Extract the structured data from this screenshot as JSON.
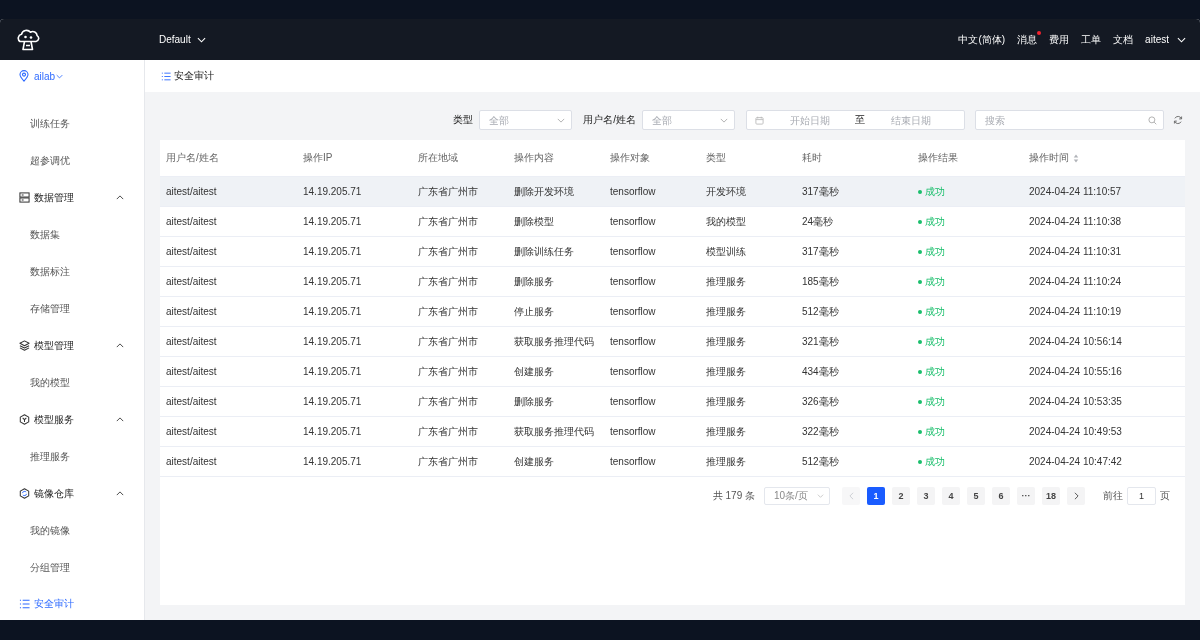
{
  "header": {
    "workspace": "Default",
    "nav": [
      {
        "label": "中文(简体)",
        "dot": false
      },
      {
        "label": "消息",
        "dot": true
      },
      {
        "label": "费用",
        "dot": false
      },
      {
        "label": "工单",
        "dot": false
      },
      {
        "label": "文档",
        "dot": false
      }
    ],
    "user": "aitest"
  },
  "sidebar": {
    "project": "ailab",
    "menu": [
      {
        "kind": "tail",
        "children": [
          {
            "label": "训练任务",
            "selected": false
          },
          {
            "label": "超参调优",
            "selected": false
          }
        ]
      },
      {
        "kind": "group",
        "label": "数据管理",
        "expanded": true,
        "children": [
          {
            "label": "数据集",
            "selected": false
          },
          {
            "label": "数据标注",
            "selected": false
          },
          {
            "label": "存储管理",
            "selected": false
          }
        ]
      },
      {
        "kind": "group",
        "label": "模型管理",
        "expanded": true,
        "children": [
          {
            "label": "我的模型",
            "selected": false
          }
        ]
      },
      {
        "kind": "group",
        "label": "模型服务",
        "expanded": true,
        "children": [
          {
            "label": "推理服务",
            "selected": false
          }
        ]
      },
      {
        "kind": "group",
        "label": "镜像仓库",
        "expanded": true,
        "children": [
          {
            "label": "我的镜像",
            "selected": false
          },
          {
            "label": "分组管理",
            "selected": false
          }
        ]
      },
      {
        "kind": "item",
        "label": "安全审计",
        "selected": true
      }
    ]
  },
  "page_title": "安全审计",
  "filters": {
    "type_label": "类型",
    "type_select": {
      "placeholder": "全部"
    },
    "user_label": "用户名/姓名",
    "user_select": {
      "placeholder": "全部"
    },
    "date_range": {
      "start_placeholder": "开始日期",
      "separator": "至",
      "end_placeholder": "结束日期"
    },
    "search": {
      "placeholder": "搜索"
    }
  },
  "table": {
    "columns": [
      {
        "label": "用户名/姓名",
        "kind": "text",
        "sortable": false
      },
      {
        "label": "操作IP",
        "kind": "text",
        "sortable": false
      },
      {
        "label": "所在地域",
        "kind": "text",
        "sortable": false
      },
      {
        "label": "操作内容",
        "kind": "text",
        "sortable": false
      },
      {
        "label": "操作对象",
        "kind": "text",
        "sortable": false
      },
      {
        "label": "类型",
        "kind": "text",
        "sortable": false
      },
      {
        "label": "耗时",
        "kind": "text",
        "sortable": false
      },
      {
        "label": "操作结果",
        "kind": "status",
        "sortable": false
      },
      {
        "label": "操作时间",
        "kind": "text",
        "sortable": true
      }
    ],
    "rows": [
      {
        "highlighted": true,
        "color": "#19be6b",
        "cells": [
          "aitest/aitest",
          "14.19.205.71",
          "广东省广州市",
          "删除开发环境",
          "tensorflow",
          "开发环境",
          "317毫秒",
          "成功",
          "2024-04-24 11:10:57"
        ]
      },
      {
        "highlighted": false,
        "color": "#19be6b",
        "cells": [
          "aitest/aitest",
          "14.19.205.71",
          "广东省广州市",
          "删除模型",
          "tensorflow",
          "我的模型",
          "24毫秒",
          "成功",
          "2024-04-24 11:10:38"
        ]
      },
      {
        "highlighted": false,
        "color": "#19be6b",
        "cells": [
          "aitest/aitest",
          "14.19.205.71",
          "广东省广州市",
          "删除训练任务",
          "tensorflow",
          "模型训练",
          "317毫秒",
          "成功",
          "2024-04-24 11:10:31"
        ]
      },
      {
        "highlighted": false,
        "color": "#19be6b",
        "cells": [
          "aitest/aitest",
          "14.19.205.71",
          "广东省广州市",
          "删除服务",
          "tensorflow",
          "推理服务",
          "185毫秒",
          "成功",
          "2024-04-24 11:10:24"
        ]
      },
      {
        "highlighted": false,
        "color": "#19be6b",
        "cells": [
          "aitest/aitest",
          "14.19.205.71",
          "广东省广州市",
          "停止服务",
          "tensorflow",
          "推理服务",
          "512毫秒",
          "成功",
          "2024-04-24 11:10:19"
        ]
      },
      {
        "highlighted": false,
        "color": "#19be6b",
        "cells": [
          "aitest/aitest",
          "14.19.205.71",
          "广东省广州市",
          "获取服务推理代码",
          "tensorflow",
          "推理服务",
          "321毫秒",
          "成功",
          "2024-04-24 10:56:14"
        ]
      },
      {
        "highlighted": false,
        "color": "#19be6b",
        "cells": [
          "aitest/aitest",
          "14.19.205.71",
          "广东省广州市",
          "创建服务",
          "tensorflow",
          "推理服务",
          "434毫秒",
          "成功",
          "2024-04-24 10:55:16"
        ]
      },
      {
        "highlighted": false,
        "color": "#19be6b",
        "cells": [
          "aitest/aitest",
          "14.19.205.71",
          "广东省广州市",
          "删除服务",
          "tensorflow",
          "推理服务",
          "326毫秒",
          "成功",
          "2024-04-24 10:53:35"
        ]
      },
      {
        "highlighted": false,
        "color": "#19be6b",
        "cells": [
          "aitest/aitest",
          "14.19.205.71",
          "广东省广州市",
          "获取服务推理代码",
          "tensorflow",
          "推理服务",
          "322毫秒",
          "成功",
          "2024-04-24 10:49:53"
        ]
      },
      {
        "highlighted": false,
        "color": "#19be6b",
        "cells": [
          "aitest/aitest",
          "14.19.205.71",
          "广东省广州市",
          "创建服务",
          "tensorflow",
          "推理服务",
          "512毫秒",
          "成功",
          "2024-04-24 10:47:42"
        ]
      }
    ]
  },
  "pagination": {
    "total": "共 179 条",
    "page_size": "10条/页",
    "prev_disabled": true,
    "pages": [
      {
        "label": "1",
        "selected": true
      },
      {
        "label": "2",
        "selected": false
      },
      {
        "label": "3",
        "selected": false
      },
      {
        "label": "4",
        "selected": false
      },
      {
        "label": "5",
        "selected": false
      },
      {
        "label": "6",
        "selected": false
      },
      {
        "label": "···",
        "selected": false
      },
      {
        "label": "18",
        "selected": false
      }
    ],
    "next_disabled": false,
    "jump_label": "前往",
    "jump_value": "1",
    "jump_suffix": "页"
  }
}
